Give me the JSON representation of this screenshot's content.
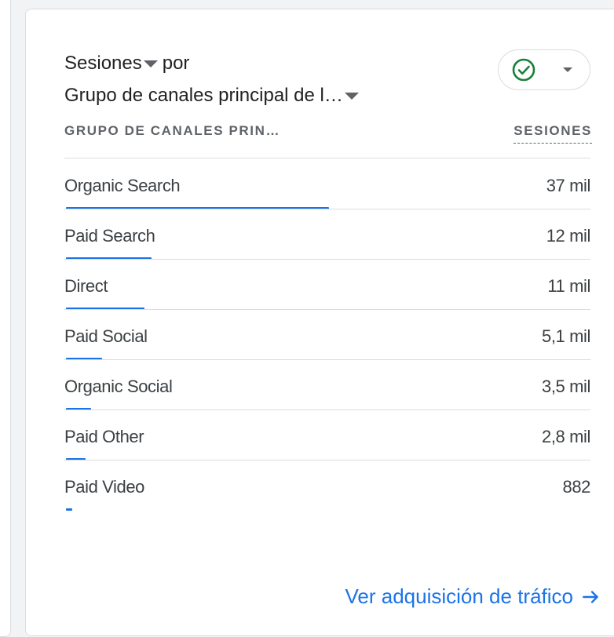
{
  "card": {
    "metric_label": "Sesiones",
    "connector": "por",
    "dimension_label": "Grupo de canales principal de l…",
    "table": {
      "dimension_header": "GRUPO DE CANALES PRIN…",
      "metric_header": "SESIONES",
      "rows": [
        {
          "name": "Organic Search",
          "value": "37 mil",
          "fraction": 0.4554
        },
        {
          "name": "Paid Search",
          "value": "12 mil",
          "fraction": 0.1477
        },
        {
          "name": "Direct",
          "value": "11 mil",
          "fraction": 0.1354
        },
        {
          "name": "Paid Social",
          "value": "5,1 mil",
          "fraction": 0.0628
        },
        {
          "name": "Organic Social",
          "value": "3,5 mil",
          "fraction": 0.0431
        },
        {
          "name": "Paid Other",
          "value": "2,8 mil",
          "fraction": 0.0345
        },
        {
          "name": "Paid Video",
          "value": "882",
          "fraction": 0.0109
        }
      ]
    },
    "footer_link": "Ver adquisición de tráfico"
  },
  "colors": {
    "accent": "#1a73e8",
    "success": "#188038",
    "border": "#dadce0",
    "text": "#3c4043"
  },
  "icons": {
    "status": "check-circle-icon",
    "dropdown": "chevron-down-icon",
    "footer": "arrow-right-icon"
  }
}
